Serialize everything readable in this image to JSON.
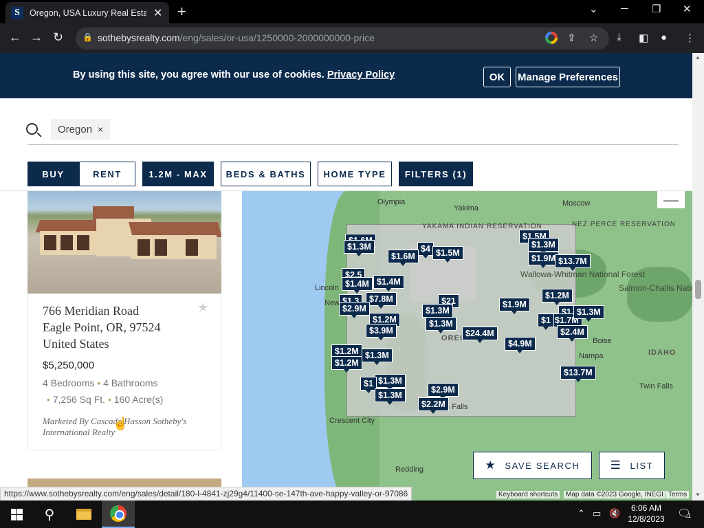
{
  "browser": {
    "tab_title": "Oregon, USA Luxury Real Estate",
    "favicon_letter": "S",
    "url_host": "sothebysrealty.com",
    "url_path": "/eng/sales/or-usa/1250000-2000000000-price",
    "status_url": "https://www.sothebysrealty.com/eng/sales/detail/180-l-4841-zj29g4/11400-se-147th-ave-happy-valley-or-97086"
  },
  "cookie": {
    "text": "By using this site, you agree with our use of cookies.",
    "link": "Privacy Policy",
    "ok_label": "OK",
    "prefs_label": "Manage Preferences"
  },
  "search": {
    "chip": "Oregon",
    "chip_close": "×"
  },
  "filters": {
    "buy": "BUY",
    "rent": "RENT",
    "price": "1.2M - MAX",
    "beds": "BEDS & BATHS",
    "home_type": "HOME TYPE",
    "more": "FILTERS (1)"
  },
  "listing": {
    "address_line1": "766 Meridian Road",
    "address_line2": "Eagle Point, OR, 97524",
    "address_line3": "United States",
    "price": "$5,250,000",
    "bedrooms": "4 Bedrooms",
    "bathrooms": "4 Bathrooms",
    "sqft": "7,256 Sq Ft.",
    "acres": "160 Acre(s)",
    "marketed_by": "Marketed By Cascade Hasson Sotheby's International Realty"
  },
  "map": {
    "labels": {
      "olympia": "Olympia",
      "yakima": "Yakima",
      "moscow": "Moscow",
      "yakama": "YAKAMA INDIAN RESERVATION",
      "nez_perce": "NEZ PERCE RESERVATION",
      "wallowa": "Wallowa-Whitman National Forest",
      "salmon": "Salmon-Challis National Forest",
      "lincoln": "Lincoln",
      "new": "New",
      "boise": "Boise",
      "nampa": "Nampa",
      "idaho": "IDAHO",
      "twin_falls": "Twin Falls",
      "crescent": "Crescent City",
      "redding": "Redding",
      "oregon_fragment": "OREG",
      "klamath_fragment": "th Falls"
    },
    "pins": [
      "$1.6M",
      "$1.3M",
      "$4",
      "$1.6M",
      "$1.5M",
      "$1.5M",
      "$1.3M",
      "$1.9M",
      "$13.7M",
      "$2.5",
      "$1.4M",
      "$1.4M",
      "$1.3",
      "$7.8M",
      "$2.9M",
      "$21",
      "$1.3M",
      "$1.9M",
      "$1.2M",
      "$1.3M",
      "$1.2M",
      "$3.9M",
      "$24.4M",
      "$1.3M",
      "$4.9M",
      "$1.2M",
      "$1.3M",
      "$1.3M",
      "$2.9M",
      "$2.2M",
      "$13.7M",
      "$1",
      "$1.3M",
      "$1.2M",
      "$1.7M",
      "$2.4M",
      "$1",
      "$1.3M"
    ],
    "save_search": "SAVE SEARCH",
    "list": "LIST",
    "shortcuts": "Keyboard shortcuts",
    "mapdata": "Map data ©2023 Google, INEGI",
    "terms": "Terms"
  },
  "taskbar": {
    "time": "6:06 AM",
    "date": "12/8/2023",
    "notif_count": "1"
  },
  "colors": {
    "navy": "#0c2a4c"
  }
}
